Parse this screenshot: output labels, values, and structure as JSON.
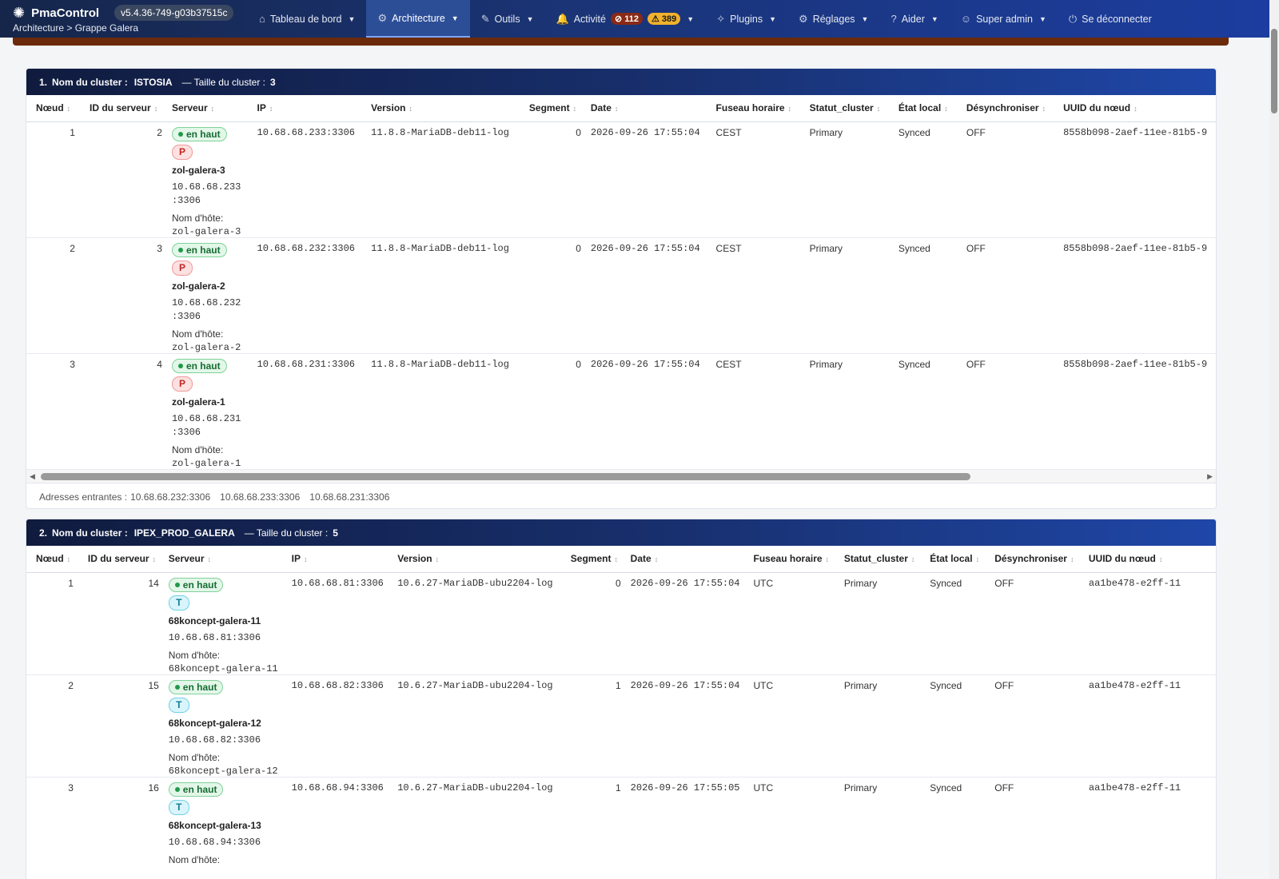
{
  "app": {
    "name": "PmaControl",
    "version": "v5.4.36-749-g03b37515c",
    "breadcrumb": "Architecture > Grappe Galera"
  },
  "nav": [
    {
      "label": "Tableau de bord",
      "icon": "home-icon",
      "glyph": "⌂",
      "active": false,
      "caret": true
    },
    {
      "label": "Architecture",
      "icon": "architecture-icon",
      "glyph": "⚙",
      "active": true,
      "caret": true
    },
    {
      "label": "Outils",
      "icon": "wrench-icon",
      "glyph": "✎",
      "active": false,
      "caret": true
    },
    {
      "label": "Activité",
      "icon": "bell-icon",
      "glyph": "🔔",
      "active": false,
      "caret": true,
      "badges": [
        {
          "type": "err",
          "text": "⊘ 112"
        },
        {
          "type": "warn",
          "text": "⚠ 389"
        }
      ]
    },
    {
      "label": "Plugins",
      "icon": "plugin-icon",
      "glyph": "✧",
      "active": false,
      "caret": true
    },
    {
      "label": "Réglages",
      "icon": "gear-icon",
      "glyph": "⚙",
      "active": false,
      "caret": true
    },
    {
      "label": "Aider",
      "icon": "help-icon",
      "glyph": "?",
      "active": false,
      "caret": true
    },
    {
      "label": "Super admin",
      "icon": "user-icon",
      "glyph": "☺",
      "active": false,
      "caret": true
    },
    {
      "label": "Se déconnecter",
      "icon": "power-icon",
      "glyph": "⏻",
      "active": false,
      "caret": false
    }
  ],
  "columns": [
    "Nœud",
    "ID du serveur",
    "Serveur",
    "IP",
    "Version",
    "Segment",
    "Date",
    "Fuseau horaire",
    "Statut_cluster",
    "État local",
    "Désynchroniser",
    "UUID du nœud"
  ],
  "clusters": [
    {
      "index": "1.",
      "name_label": "Nom du cluster :",
      "name": "ISTOSIA",
      "size_label": "— Taille du cluster :",
      "size": "3",
      "incoming_label": "Adresses entrantes :",
      "incoming": [
        "10.68.68.232:3306",
        "10.68.68.233:3306",
        "10.68.68.231:3306"
      ],
      "rows": [
        {
          "node": "1",
          "server_id": "2",
          "status": "en haut",
          "role": "P",
          "server_name": "zol-galera-3",
          "server_ip": "10.68.68.233\n:3306",
          "host_label": "Nom d'hôte:",
          "host": "zol-galera-3",
          "ip": "10.68.68.233:3306",
          "version": "11.8.8-MariaDB-deb11-log",
          "segment": "0",
          "date": "2026-09-26 17:55:04",
          "tz": "CEST",
          "cluster_status": "Primary",
          "local_state": "Synced",
          "desync": "OFF",
          "uuid": "8558b098-2aef-11ee-81b5-9"
        },
        {
          "node": "2",
          "server_id": "3",
          "status": "en haut",
          "role": "P",
          "server_name": "zol-galera-2",
          "server_ip": "10.68.68.232\n:3306",
          "host_label": "Nom d'hôte:",
          "host": "zol-galera-2",
          "ip": "10.68.68.232:3306",
          "version": "11.8.8-MariaDB-deb11-log",
          "segment": "0",
          "date": "2026-09-26 17:55:04",
          "tz": "CEST",
          "cluster_status": "Primary",
          "local_state": "Synced",
          "desync": "OFF",
          "uuid": "8558b098-2aef-11ee-81b5-9"
        },
        {
          "node": "3",
          "server_id": "4",
          "status": "en haut",
          "role": "P",
          "server_name": "zol-galera-1",
          "server_ip": "10.68.68.231\n:3306",
          "host_label": "Nom d'hôte:",
          "host": "zol-galera-1",
          "ip": "10.68.68.231:3306",
          "version": "11.8.8-MariaDB-deb11-log",
          "segment": "0",
          "date": "2026-09-26 17:55:04",
          "tz": "CEST",
          "cluster_status": "Primary",
          "local_state": "Synced",
          "desync": "OFF",
          "uuid": "8558b098-2aef-11ee-81b5-9"
        }
      ]
    },
    {
      "index": "2.",
      "name_label": "Nom du cluster :",
      "name": "IPEX_PROD_GALERA",
      "size_label": "— Taille du cluster :",
      "size": "5",
      "rows": [
        {
          "node": "1",
          "server_id": "14",
          "status": "en haut",
          "role": "T",
          "server_name": "68koncept-galera-11",
          "server_ip": "10.68.68.81:3306",
          "host_label": "Nom d'hôte:",
          "host": "68koncept-galera-11",
          "ip": "10.68.68.81:3306",
          "version": "10.6.27-MariaDB-ubu2204-log",
          "segment": "0",
          "date": "2026-09-26 17:55:04",
          "tz": "UTC",
          "cluster_status": "Primary",
          "local_state": "Synced",
          "desync": "OFF",
          "uuid": "aa1be478-e2ff-11"
        },
        {
          "node": "2",
          "server_id": "15",
          "status": "en haut",
          "role": "T",
          "server_name": "68koncept-galera-12",
          "server_ip": "10.68.68.82:3306",
          "host_label": "Nom d'hôte:",
          "host": "68koncept-galera-12",
          "ip": "10.68.68.82:3306",
          "version": "10.6.27-MariaDB-ubu2204-log",
          "segment": "1",
          "date": "2026-09-26 17:55:04",
          "tz": "UTC",
          "cluster_status": "Primary",
          "local_state": "Synced",
          "desync": "OFF",
          "uuid": "aa1be478-e2ff-11"
        },
        {
          "node": "3",
          "server_id": "16",
          "status": "en haut",
          "role": "T",
          "server_name": "68koncept-galera-13",
          "server_ip": "10.68.68.94:3306",
          "host_label": "Nom d'hôte:",
          "host": "",
          "ip": "10.68.68.94:3306",
          "version": "10.6.27-MariaDB-ubu2204-log",
          "segment": "1",
          "date": "2026-09-26 17:55:05",
          "tz": "UTC",
          "cluster_status": "Primary",
          "local_state": "Synced",
          "desync": "OFF",
          "uuid": "aa1be478-e2ff-11"
        }
      ]
    }
  ]
}
